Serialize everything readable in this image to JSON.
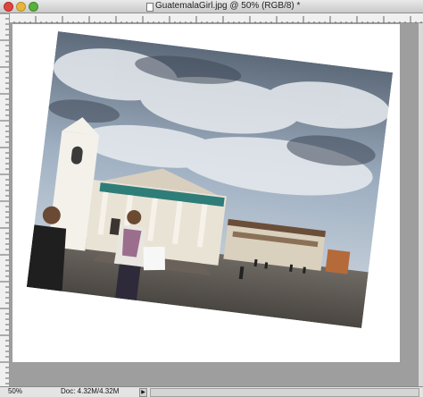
{
  "window": {
    "title": "GuatemalaGirl.jpg @ 50% (RGB/8)",
    "modified_marker": "*"
  },
  "status": {
    "zoom": "50%",
    "doc_info": "Doc: 4.32M/4.32M",
    "menu_arrow": "▶"
  },
  "colors": {
    "close": "#e0443e",
    "minimize": "#e7b53a",
    "zoom": "#5ab03e",
    "pasteboard": "#9e9e9e",
    "canvas": "#ffffff"
  },
  "photo": {
    "rotation_degrees": 7,
    "subject": "photo of a colonial church plaza with a girl in the foreground"
  }
}
